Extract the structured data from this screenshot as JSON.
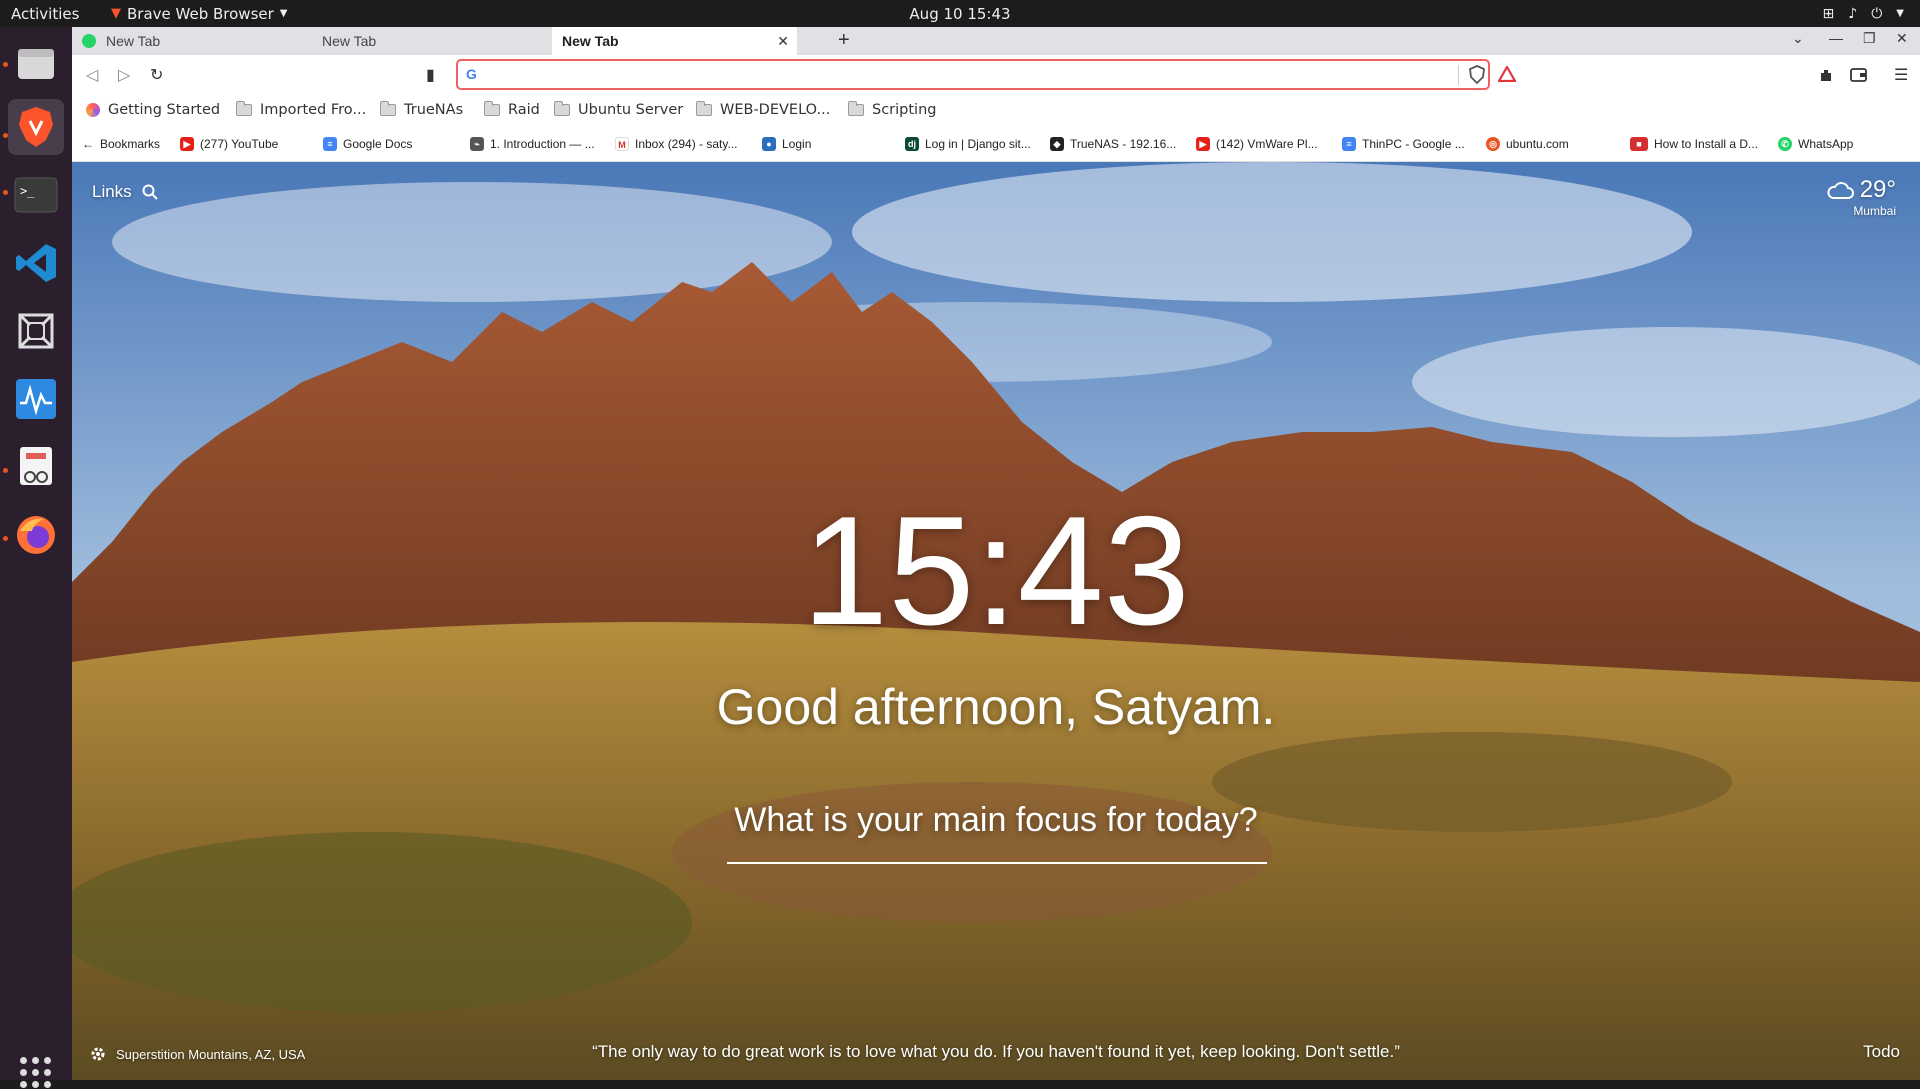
{
  "topbar": {
    "activities": "Activities",
    "app_name": "Brave Web Browser",
    "datetime": "Aug 10  15:43"
  },
  "tabs": [
    {
      "label": "New Tab",
      "active": false
    },
    {
      "label": "New Tab",
      "active": false
    },
    {
      "label": "New Tab",
      "active": true
    }
  ],
  "tab_close": "✕",
  "new_tab_button": "+",
  "omnibox": {
    "value": "",
    "placeholder": ""
  },
  "bookmarks_bar": {
    "items": [
      {
        "label": "Getting Started"
      },
      {
        "label": "Imported Fro..."
      },
      {
        "label": "TrueNAs"
      },
      {
        "label": "Raid"
      },
      {
        "label": "Ubuntu Server"
      },
      {
        "label": "WEB-DEVELO..."
      },
      {
        "label": "Scripting"
      }
    ]
  },
  "bookmarks_extension_bar": {
    "items": [
      {
        "label": "Bookmarks"
      },
      {
        "label": "(277) YouTube"
      },
      {
        "label": "Google Docs"
      },
      {
        "label": "1. Introduction — ..."
      },
      {
        "label": "Inbox (294) - saty..."
      },
      {
        "label": "Login"
      },
      {
        "label": "Log in | Django sit..."
      },
      {
        "label": "TrueNAS - 192.16..."
      },
      {
        "label": "(142) VmWare Pl..."
      },
      {
        "label": "ThinPC - Google ..."
      },
      {
        "label": "ubuntu.com"
      },
      {
        "label": "How to Install a D..."
      },
      {
        "label": "WhatsApp"
      }
    ]
  },
  "momentum": {
    "links_label": "Links",
    "weather_temp": "29°",
    "weather_city": "Mumbai",
    "time": "15:43",
    "greeting": "Good afternoon, Satyam.",
    "focus_question": "What is your main focus for today?",
    "focus_value": "",
    "photo_location": "Superstition Mountains, AZ, USA",
    "quote": "“The only way to do great work is to love what you do. If you haven't found it yet, keep looking. Don't settle.”",
    "todo_label": "Todo"
  },
  "colors": {
    "accent_brave": "#fb542b",
    "omnibox_border": "#f06262",
    "dock_bg": "#2b1f2e",
    "topbar_bg": "#1c1c1c"
  }
}
